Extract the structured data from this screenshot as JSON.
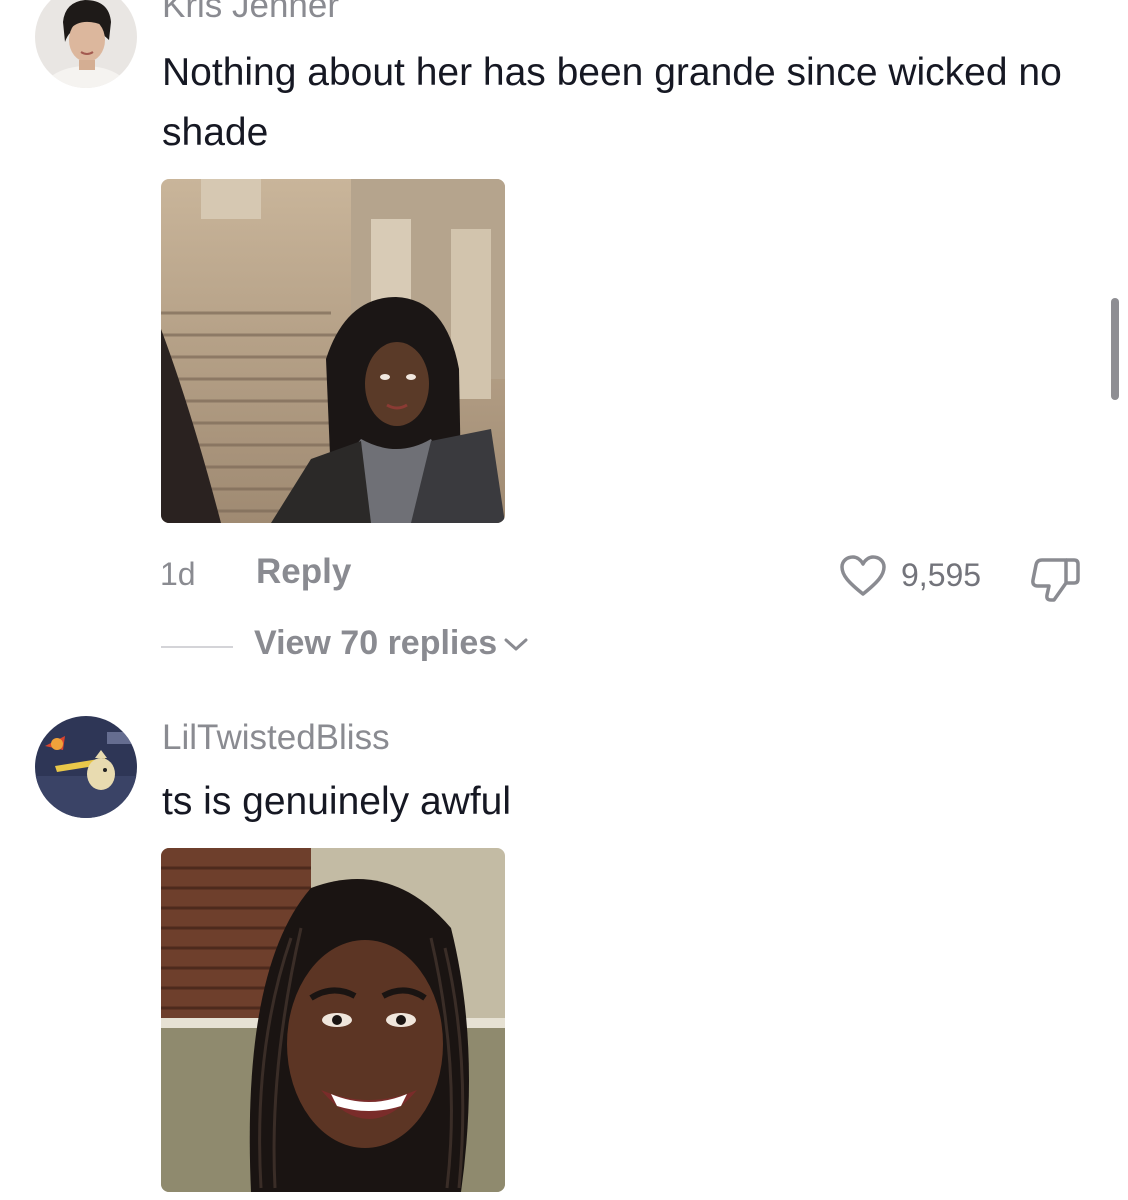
{
  "comments": [
    {
      "username": "Kris Jenner",
      "text": "Nothing about her has been grande since wicked no shade",
      "timestamp": "1d",
      "reply_label": "Reply",
      "like_count": "9,595",
      "view_replies_label": "View 70 replies"
    },
    {
      "username": "LilTwistedBliss",
      "text": "ts is genuinely awful"
    }
  ],
  "icons": {
    "like": "heart-outline-icon",
    "dislike": "thumbs-down-outline-icon",
    "expand": "chevron-down-icon"
  },
  "colors": {
    "secondary_text": "#8a8b91",
    "primary_text": "#161823",
    "scrollbar": "#8e8e93"
  }
}
